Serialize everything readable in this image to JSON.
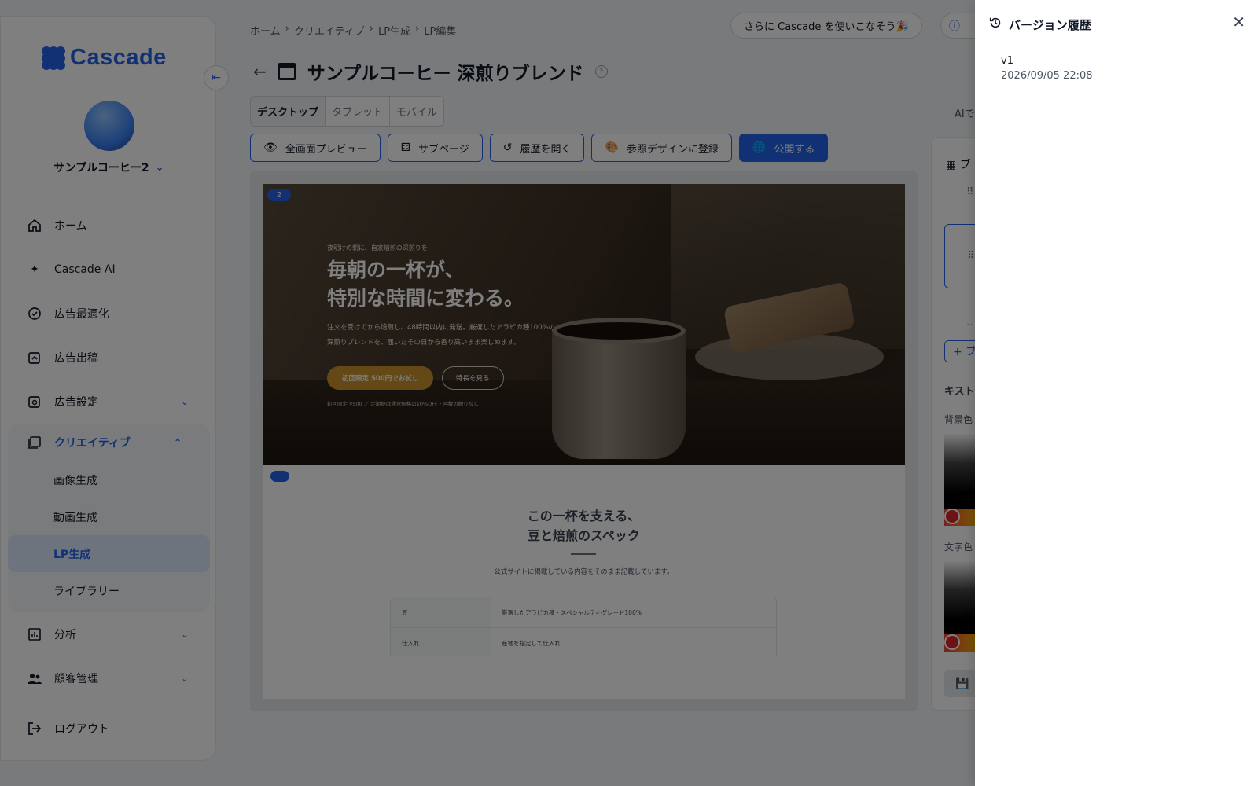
{
  "brand": {
    "name": "Cascade",
    "accent": "#2563eb"
  },
  "sidebar": {
    "account_name": "サンプルコーヒー2",
    "items": [
      {
        "label": "ホーム",
        "icon": "home-icon"
      },
      {
        "label": "Cascade AI",
        "icon": "sparkle-icon"
      },
      {
        "label": "広告最適化",
        "icon": "optimize-icon"
      },
      {
        "label": "広告出稿",
        "icon": "ad-post-icon"
      },
      {
        "label": "広告設定",
        "icon": "ad-settings-icon"
      },
      {
        "label": "クリエイティブ",
        "icon": "gallery-icon"
      },
      {
        "label": "分析",
        "icon": "chart-icon"
      },
      {
        "label": "顧客管理",
        "icon": "users-icon"
      },
      {
        "label": "ログアウト",
        "icon": "logout-icon"
      }
    ],
    "creative_sub": [
      "画像生成",
      "動画生成",
      "LP生成",
      "ライブラリー"
    ],
    "active_sub": "LP生成"
  },
  "header": {
    "breadcrumb": [
      "ホーム",
      "クリエイティブ",
      "LP生成",
      "LP編集"
    ],
    "promo": "さらに Cascade を使いこなそう🎉",
    "title": "サンプルコーヒー 深煎りブレンド"
  },
  "device_tabs": [
    "デスクトップ",
    "タブレット",
    "モバイル"
  ],
  "actions": {
    "fullscreen": "全画面プレビュー",
    "subpage": "サブページ",
    "history": "履歴を開く",
    "register": "参照デザインに登録",
    "publish": "公開する"
  },
  "ai_label": "AIで",
  "lp": {
    "section_badge": "2",
    "kicker": "夜明けの朝に、自家焙煎の深煎りを",
    "headline_line1": "毎朝の一杯が、",
    "headline_line2": "特別な時間に変わる。",
    "body_line1": "注文を受けてから焙煎し、48時間以内に発送。厳選したアラビカ種100%の",
    "body_line2": "深煎りブレンドを、届いたその日から香り高いまま楽しめます。",
    "cta_primary": "初回限定 500円でお試し",
    "cta_secondary": "特長を見る",
    "note": "初回限定 ¥500 ／ 定期便は通常価格の10%OFF・回数の縛りなし",
    "spec_title_line1": "この一杯を支える、",
    "spec_title_line2": "豆と焙煎のスペック",
    "spec_sub": "公式サイトに掲載している内容をそのまま記載しています。",
    "spec_rows": [
      {
        "k": "豆",
        "v": "厳選したアラビカ種・スペシャルティグレード100%"
      },
      {
        "k": "仕入れ",
        "v": "産地を指定して仕入れ"
      }
    ]
  },
  "right_panel": {
    "heading": "ブ",
    "add": "+ ブ",
    "text_label": "キスト",
    "bg_label": "背景色",
    "fg_label": "文字色"
  },
  "drawer": {
    "title": "バージョン履歴",
    "version": "v1",
    "date": "2026/09/05 22:08"
  }
}
